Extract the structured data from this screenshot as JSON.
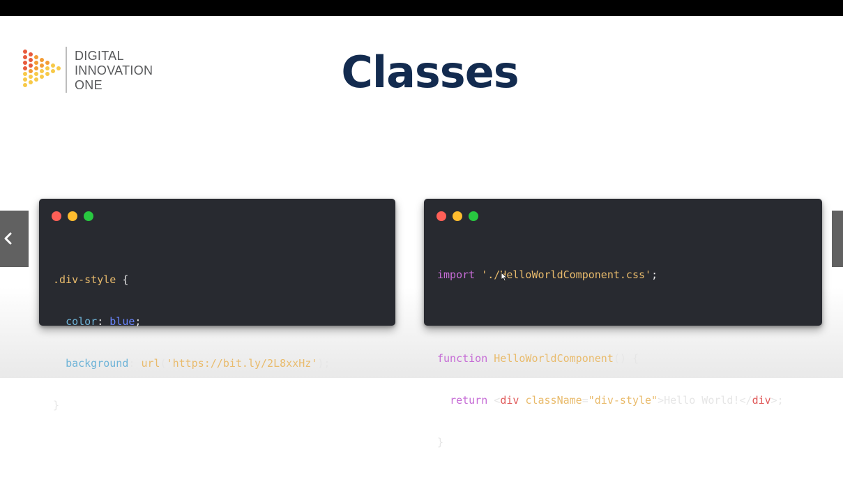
{
  "slide": {
    "title": "Classes",
    "logo": {
      "line1": "DIGITAL",
      "line2": "INNOVATION",
      "line3": "ONE",
      "icon": "play-triangle-dots-icon",
      "colors": [
        "#e85a3c",
        "#f39c34",
        "#f7c948"
      ]
    }
  },
  "window_controls": {
    "close_color": "#ff5f57",
    "minimize_color": "#febc2e",
    "maximize_color": "#28c840"
  },
  "code_left": {
    "line1": {
      "selector": ".div-style",
      "brace": " {"
    },
    "line2": {
      "indent": "  ",
      "prop": "color",
      "colon": ": ",
      "value": "blue",
      "end": ";"
    },
    "line3": {
      "indent": "  ",
      "prop": "background",
      "colon": ": ",
      "func": "url",
      "open": "(",
      "string": "'https://bit.ly/2L8xxHz'",
      "close": ");"
    },
    "line4": {
      "brace": "}"
    }
  },
  "code_right": {
    "line1": {
      "keyword": "import",
      "space": " ",
      "string": "'./HelloWorldComponent.css'",
      "end": ";"
    },
    "line3": {
      "keyword": "function",
      "space": " ",
      "name": "HelloWorldComponent",
      "rest": "() {"
    },
    "line4": {
      "indent": "  ",
      "keyword": "return",
      "space": " ",
      "lt": "<",
      "tag": "div",
      "space2": " ",
      "attr": "className",
      "eq": "=",
      "attr_value": "\"div-style\"",
      "text": ">Hello World!</",
      "close_tag": "div",
      "end": ">;"
    },
    "line5": {
      "brace": "}"
    }
  },
  "nav": {
    "prev_icon": "chevron-left-icon",
    "next_icon": "chevron-right-icon"
  },
  "icons": {
    "cursor": "mouse-pointer-icon"
  }
}
